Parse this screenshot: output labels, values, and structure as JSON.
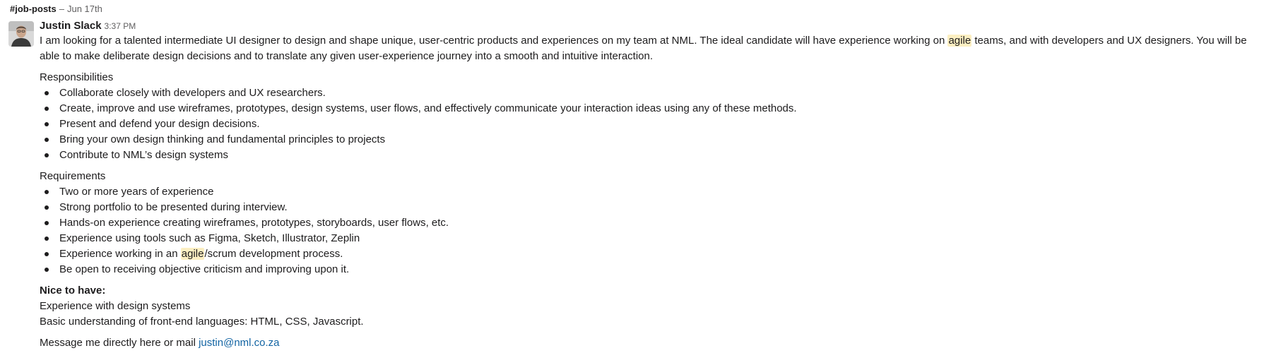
{
  "channel": {
    "hash": "#",
    "name": "job-posts",
    "separator": "–",
    "date": "Jun 17th"
  },
  "message": {
    "author": "Justin Slack",
    "time": "3:37 PM",
    "intro": {
      "part1": "I am looking for a talented intermediate UI designer to design and shape unique, user-centric products and experiences on my team at NML. The ideal candidate will have experience working on ",
      "highlight": "agile",
      "part2": " teams, and with developers and UX designers. You will be able to make deliberate design decisions and to translate any given user-experience journey into a smooth and intuitive interaction."
    },
    "responsibilities": {
      "title": "Responsibilities",
      "items": [
        "Collaborate closely with developers and UX researchers.",
        "Create, improve and use wireframes, prototypes, design systems, user flows, and effectively communicate your interaction ideas using any of these methods.",
        "Present and defend your design decisions.",
        "Bring your own design thinking and fundamental principles to projects",
        "Contribute to NML’s design systems"
      ]
    },
    "requirements": {
      "title": "Requirements",
      "items": [
        "Two or more years of experience",
        "Strong portfolio to be presented during interview.",
        "Hands-on experience creating wireframes, prototypes, storyboards, user flows, etc.",
        "Experience using tools such as Figma, Sketch, Illustrator, Zeplin"
      ],
      "agile_item": {
        "before": "Experience working in an ",
        "highlight": "agile",
        "after": "/scrum development process."
      },
      "last_item": "Be open to receiving objective criticism and improving upon it."
    },
    "nice_to_have": {
      "title": "Nice to have:",
      "items": [
        "Experience with design systems",
        "Basic understanding of front-end languages: HTML, CSS, Javascript."
      ]
    },
    "contact": {
      "text": "Message me directly here or mail ",
      "email": "justin@nml.co.za"
    }
  },
  "colors": {
    "highlight": "#fcefc2",
    "link": "#1264a3",
    "text": "#1d1c1d",
    "muted": "#616061"
  }
}
